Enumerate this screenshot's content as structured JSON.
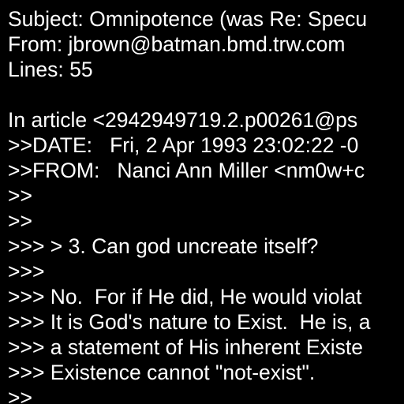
{
  "colors": {
    "background": "#000000",
    "text": "#ffffff"
  },
  "message": {
    "lines": [
      "Subject: Omnipotence (was Re: Specu",
      "From: jbrown@batman.bmd.trw.com",
      "Lines: 55",
      "",
      "In article <2942949719.2.p00261@ps",
      ">>DATE:   Fri, 2 Apr 1993 23:02:22 -0",
      ">>FROM:   Nanci Ann Miller <nm0w+c",
      ">>",
      ">>",
      ">>> > 3. Can god uncreate itself?",
      ">>>",
      ">>> No.  For if He did, He would violat",
      ">>> It is God's nature to Exist.  He is, a",
      ">>> a statement of His inherent Existe",
      ">>> Existence cannot \"not-exist\".",
      ">>"
    ]
  }
}
